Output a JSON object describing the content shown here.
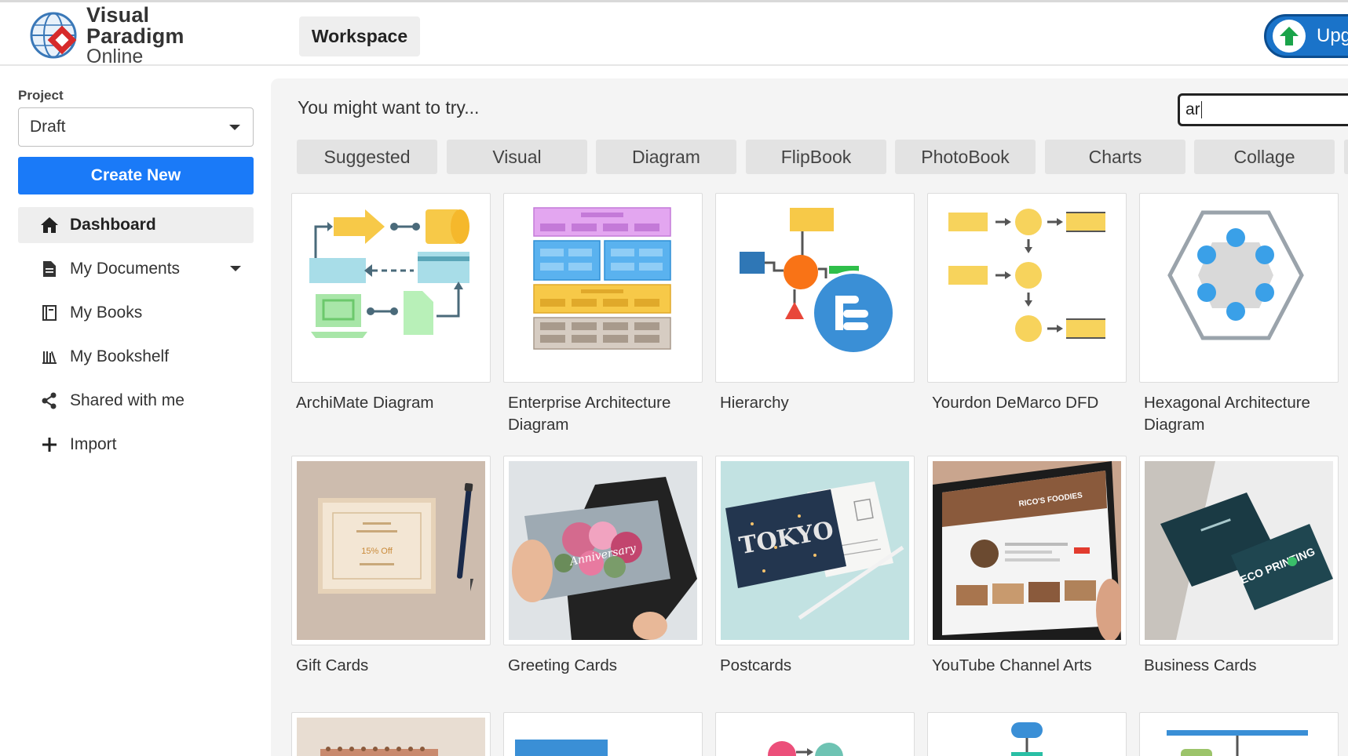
{
  "header": {
    "logo_line1": "Visual Paradigm",
    "logo_line2": "Online",
    "workspace_label": "Workspace",
    "upgrade_label": "Upg"
  },
  "sidebar": {
    "project_label": "Project",
    "project_value": "Draft",
    "create_label": "Create New",
    "nav": [
      {
        "label": "Dashboard",
        "icon": "home-icon"
      },
      {
        "label": "My Documents",
        "icon": "document-icon"
      },
      {
        "label": "My Books",
        "icon": "book-icon"
      },
      {
        "label": "My Bookshelf",
        "icon": "bookshelf-icon"
      },
      {
        "label": "Shared with me",
        "icon": "share-icon"
      },
      {
        "label": "Import",
        "icon": "plus-icon"
      }
    ]
  },
  "main": {
    "try_label": "You might want to try...",
    "search_value": "ar",
    "tabs": [
      "Suggested",
      "Visual",
      "Diagram",
      "FlipBook",
      "PhotoBook",
      "Charts",
      "Collage"
    ],
    "cards_row1": [
      "ArchiMate Diagram",
      "Enterprise Architecture Diagram",
      "Hierarchy",
      "Yourdon DeMarco DFD",
      "Hexagonal Architecture Diagram"
    ],
    "cards_row2": [
      "Gift Cards",
      "Greeting Cards",
      "Postcards",
      "YouTube Channel Arts",
      "Business Cards"
    ],
    "photo_text": {
      "gift_discount": "15% Off",
      "greeting_script": "Anniversary",
      "postcard_city": "TOKYO",
      "youtube_brand": "RICO'S FOODIES",
      "business_brand": "ECO PRINTING"
    }
  },
  "colors": {
    "primary_button": "#1a7af8",
    "upgrade_button": "#1a73c9",
    "main_background": "#f4f4f4"
  }
}
